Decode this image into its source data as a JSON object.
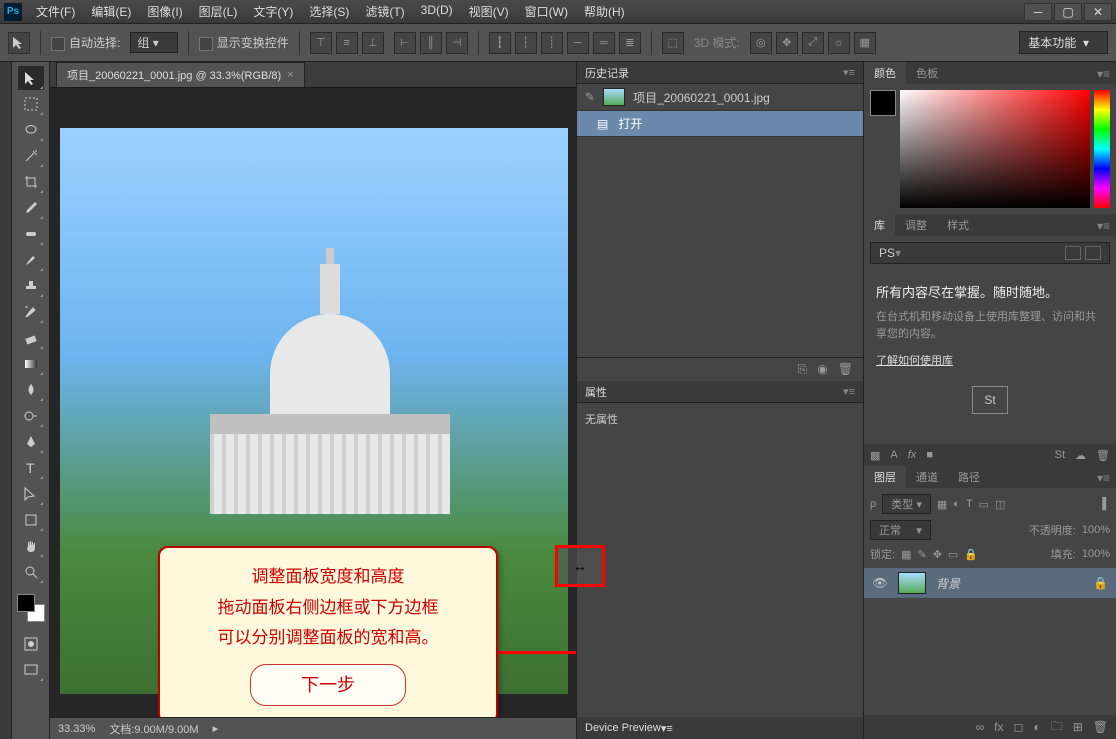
{
  "app": {
    "logo": "Ps"
  },
  "menu": [
    "文件(F)",
    "编辑(E)",
    "图像(I)",
    "图层(L)",
    "文字(Y)",
    "选择(S)",
    "滤镜(T)",
    "3D(D)",
    "视图(V)",
    "窗口(W)",
    "帮助(H)"
  ],
  "options": {
    "auto_select": "自动选择:",
    "group": "组",
    "show_transform": "显示变换控件",
    "mode3d": "3D 模式:",
    "workspace": "基本功能"
  },
  "doc": {
    "tab": "项目_20060221_0001.jpg @ 33.3%(RGB/8)",
    "zoom": "33.33%",
    "docinfo_label": "文档:",
    "docinfo_value": "9.00M/9.00M"
  },
  "history": {
    "title": "历史记录",
    "source": "项目_20060221_0001.jpg",
    "item": "打开"
  },
  "props": {
    "title": "属性",
    "none": "无属性"
  },
  "devprev": {
    "title": "Device Preview"
  },
  "color": {
    "tab1": "颜色",
    "tab2": "色板"
  },
  "library": {
    "tab1": "库",
    "tab2": "调整",
    "tab3": "样式",
    "select": "PS",
    "headline": "所有内容尽在掌握。随时随地。",
    "desc": "在台式机和移动设备上使用库整理、访问和共享您的内容。",
    "link": "了解如何使用库",
    "st": "St"
  },
  "layers": {
    "tab1": "图层",
    "tab2": "通道",
    "tab3": "路径",
    "kind": "类型",
    "blend": "正常",
    "opacity_label": "不透明度:",
    "opacity_val": "100%",
    "lock_label": "锁定:",
    "fill_label": "填充:",
    "fill_val": "100%",
    "bg": "背景"
  },
  "tutorial": {
    "title": "调整面板宽度和高度",
    "line1": "拖动面板右侧边框或下方边框",
    "line2": "可以分别调整面板的宽和高。",
    "button": "下一步"
  }
}
